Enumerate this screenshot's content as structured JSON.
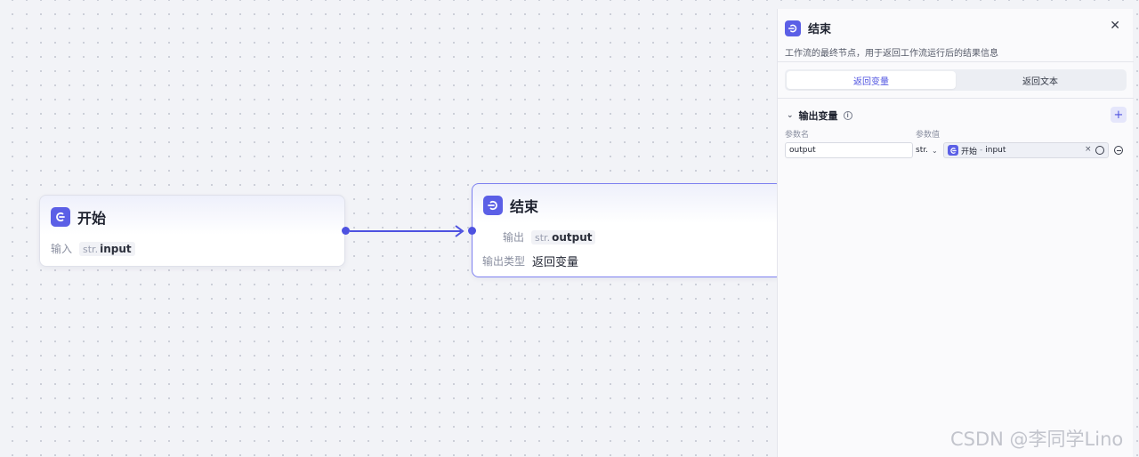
{
  "canvas": {
    "start_node": {
      "title": "开始",
      "rows": [
        {
          "label": "输入",
          "type": "str.",
          "name": "input"
        }
      ]
    },
    "end_node": {
      "title": "结束",
      "output_label": "输出",
      "output_type": "str.",
      "output_name": "output",
      "output_kind_label": "输出类型",
      "output_kind_value": "返回变量"
    }
  },
  "panel": {
    "title": "结束",
    "description": "工作流的最终节点，用于返回工作流运行后的结果信息",
    "close_icon": "close-icon",
    "tabs": [
      {
        "label": "返回变量",
        "active": true
      },
      {
        "label": "返回文本",
        "active": false
      }
    ],
    "section_title": "输出变量",
    "col_name": "参数名",
    "col_value": "参数值",
    "variable": {
      "name": "output",
      "type": "str.",
      "ref_node": "开始",
      "ref_sep": "-",
      "ref_var": "input",
      "clear": "×"
    }
  },
  "watermark": "CSDN @李同学Lino",
  "colors": {
    "accent": "#5b5fe6",
    "edge": "#4e52e0",
    "selected_border": "#7d80f0"
  }
}
